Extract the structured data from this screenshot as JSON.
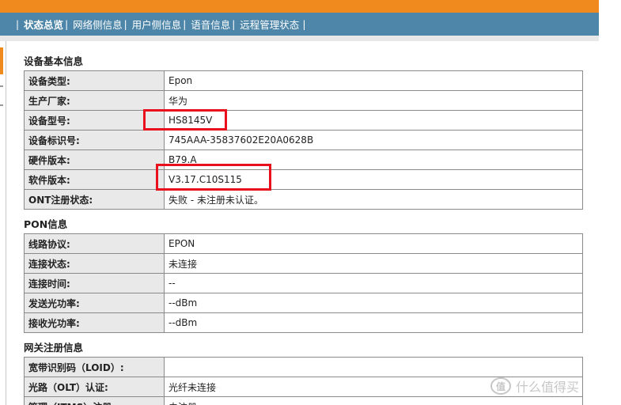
{
  "nav": {
    "items": [
      {
        "label": "状态总览",
        "active": true
      },
      {
        "label": "网络侧信息",
        "active": false
      },
      {
        "label": "用户侧信息",
        "active": false
      },
      {
        "label": "语音信息",
        "active": false
      },
      {
        "label": "远程管理状态",
        "active": false
      }
    ]
  },
  "device_info": {
    "title": "设备基本信息",
    "rows": [
      {
        "key": "设备类型:",
        "value": "Epon"
      },
      {
        "key": "生产厂家:",
        "value": "华为"
      },
      {
        "key": "设备型号:",
        "value": "HS8145V"
      },
      {
        "key": "设备标识号:",
        "value": "745AAA-35837602E20A0628B"
      },
      {
        "key": "硬件版本:",
        "value": "B79.A"
      },
      {
        "key": "软件版本:",
        "value": "V3.17.C10S115"
      },
      {
        "key": "ONT注册状态:",
        "value": "失败 - 未注册未认证。"
      }
    ]
  },
  "pon_info": {
    "title": "PON信息",
    "rows": [
      {
        "key": "线路协议:",
        "value": "EPON"
      },
      {
        "key": "连接状态:",
        "value": "未连接"
      },
      {
        "key": "连接时间:",
        "value": "--"
      },
      {
        "key": "发送光功率:",
        "value": "--dBm"
      },
      {
        "key": "接收光功率:",
        "value": "--dBm"
      }
    ]
  },
  "gateway_info": {
    "title": "网关注册信息",
    "rows": [
      {
        "key": "宽带识别码（LOID）:",
        "value": ""
      },
      {
        "key": "光路（OLT）认证:",
        "value": "光纤未连接"
      },
      {
        "key": "管理（ITMS）注册:",
        "value": "未注册"
      }
    ]
  },
  "watermark": {
    "logo": "值",
    "text": "什么值得买"
  },
  "colors": {
    "brand_orange": "#f08a1e",
    "nav_blue": "#4d86a8",
    "highlight_red": "#e8101c",
    "key_cell_bg": "#e9e9e9"
  }
}
